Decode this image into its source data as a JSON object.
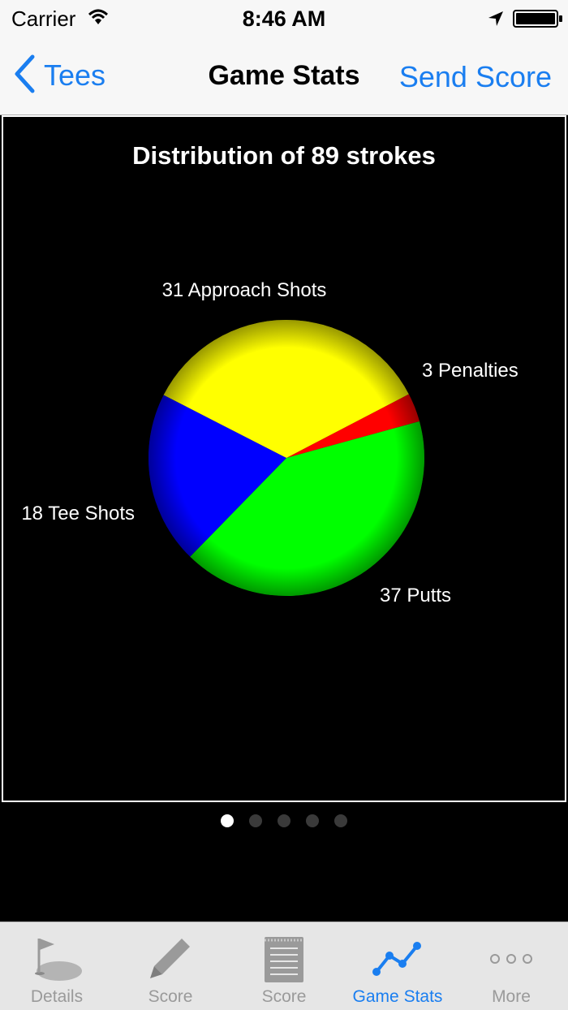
{
  "status_bar": {
    "carrier": "Carrier",
    "time": "8:46 AM"
  },
  "nav": {
    "back_label": "Tees",
    "title": "Game Stats",
    "right_action": "Send Score"
  },
  "colors": {
    "accent": "#1a7ef0",
    "tab_inactive": "#9a9a9a"
  },
  "chart_data": {
    "type": "pie",
    "title": "Distribution of 89 strokes",
    "slices": [
      {
        "label": "3 Penalties",
        "value": 3,
        "color": "#ff0000"
      },
      {
        "label": "37 Putts",
        "value": 37,
        "color": "#00ff00"
      },
      {
        "label": "18 Tee Shots",
        "value": 18,
        "color": "#0000ff"
      },
      {
        "label": "31 Approach Shots",
        "value": 31,
        "color": "#ffff00"
      }
    ]
  },
  "pager": {
    "count": 5,
    "active": 0
  },
  "tabs": [
    {
      "label": "Details",
      "icon": "golf-flag-icon",
      "active": false
    },
    {
      "label": "Score",
      "icon": "pencil-icon",
      "active": false
    },
    {
      "label": "Score",
      "icon": "notepad-icon",
      "active": false
    },
    {
      "label": "Game Stats",
      "icon": "line-graph-icon",
      "active": true
    },
    {
      "label": "More",
      "icon": "more-dots-icon",
      "active": false
    }
  ]
}
